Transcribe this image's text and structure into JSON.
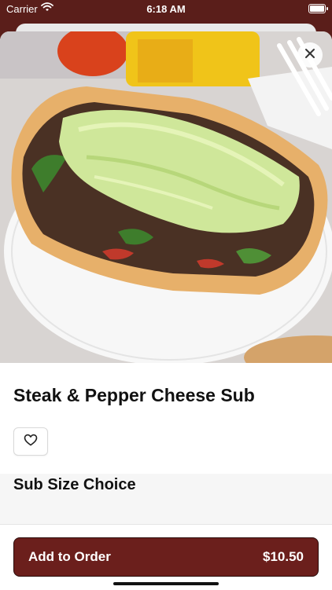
{
  "status_bar": {
    "carrier": "Carrier",
    "time": "6:18 AM",
    "icons": [
      "wifi-icon",
      "battery-icon"
    ]
  },
  "item": {
    "name": "Steak & Pepper Cheese Sub",
    "image": "photo of a steak and pepper cheese sub topped with shredded lettuce on a white paper plate"
  },
  "sections": [
    {
      "heading": "Sub Size Choice"
    }
  ],
  "actions": {
    "close_icon": "close-icon",
    "favorite_icon": "heart-icon",
    "add_label": "Add to Order",
    "price": "$10.50"
  },
  "colors": {
    "brand": "#6b1f1c",
    "status_bar_bg": "#5a1e1a",
    "section_bg": "#f6f6f6"
  }
}
